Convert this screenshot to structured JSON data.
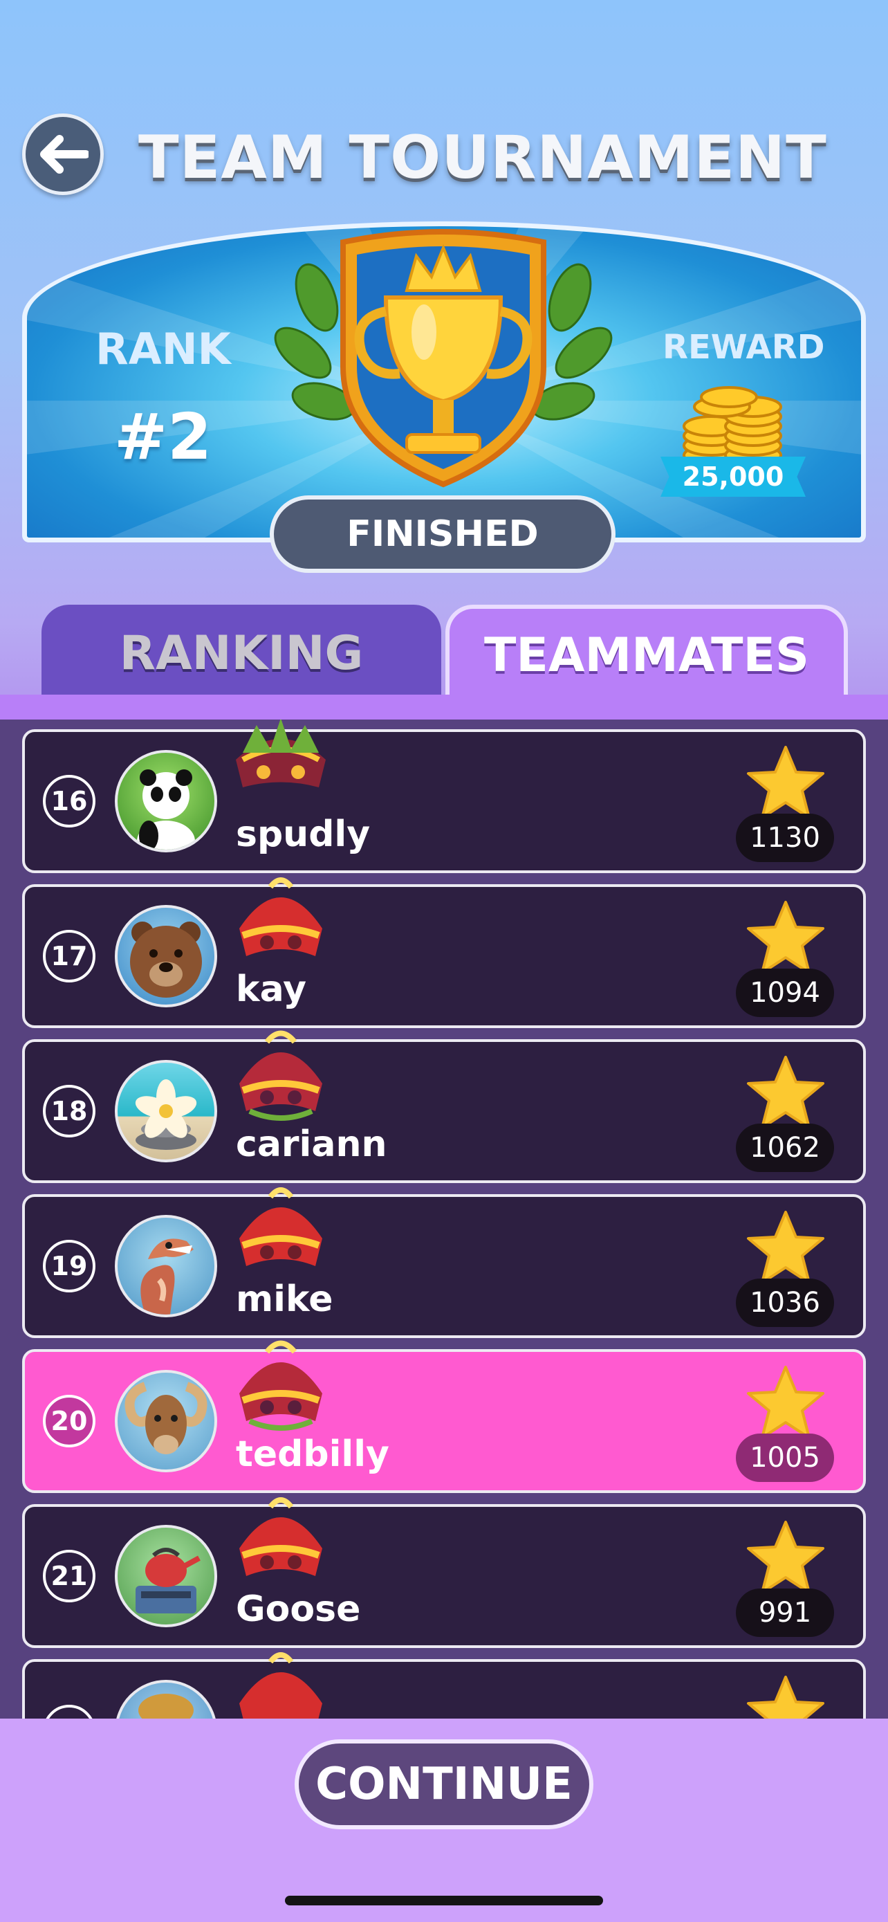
{
  "header": {
    "title": "TEAM TOURNAMENT"
  },
  "banner": {
    "rank_label": "RANK",
    "rank_value": "#2",
    "reward_label": "REWARD",
    "reward_amount": "25,000",
    "status": "FINISHED"
  },
  "tabs": {
    "ranking": "RANKING",
    "teammates": "TEAMMATES",
    "active": "TEAMMATES"
  },
  "players": [
    {
      "rank": "16",
      "name": "spudly",
      "score": "1130",
      "avatar": "panda-avatar",
      "highlighted": false
    },
    {
      "rank": "17",
      "name": "kay",
      "score": "1094",
      "avatar": "bear-avatar",
      "highlighted": false
    },
    {
      "rank": "18",
      "name": "cariann",
      "score": "1062",
      "avatar": "flower-stones-avatar",
      "highlighted": false
    },
    {
      "rank": "19",
      "name": "mike",
      "score": "1036",
      "avatar": "cobra-avatar",
      "highlighted": false
    },
    {
      "rank": "20",
      "name": "tedbilly",
      "score": "1005",
      "avatar": "ram-avatar",
      "highlighted": true
    },
    {
      "rank": "21",
      "name": "Goose",
      "score": "991",
      "avatar": "teapot-stove-avatar",
      "highlighted": false
    }
  ],
  "footer": {
    "continue_label": "CONTINUE"
  },
  "colors": {
    "highlight_row": "#ff5ad0",
    "row_bg": "#2d1f41",
    "tab_active": "#b87ff8",
    "tab_inactive": "#6b4fc2"
  }
}
